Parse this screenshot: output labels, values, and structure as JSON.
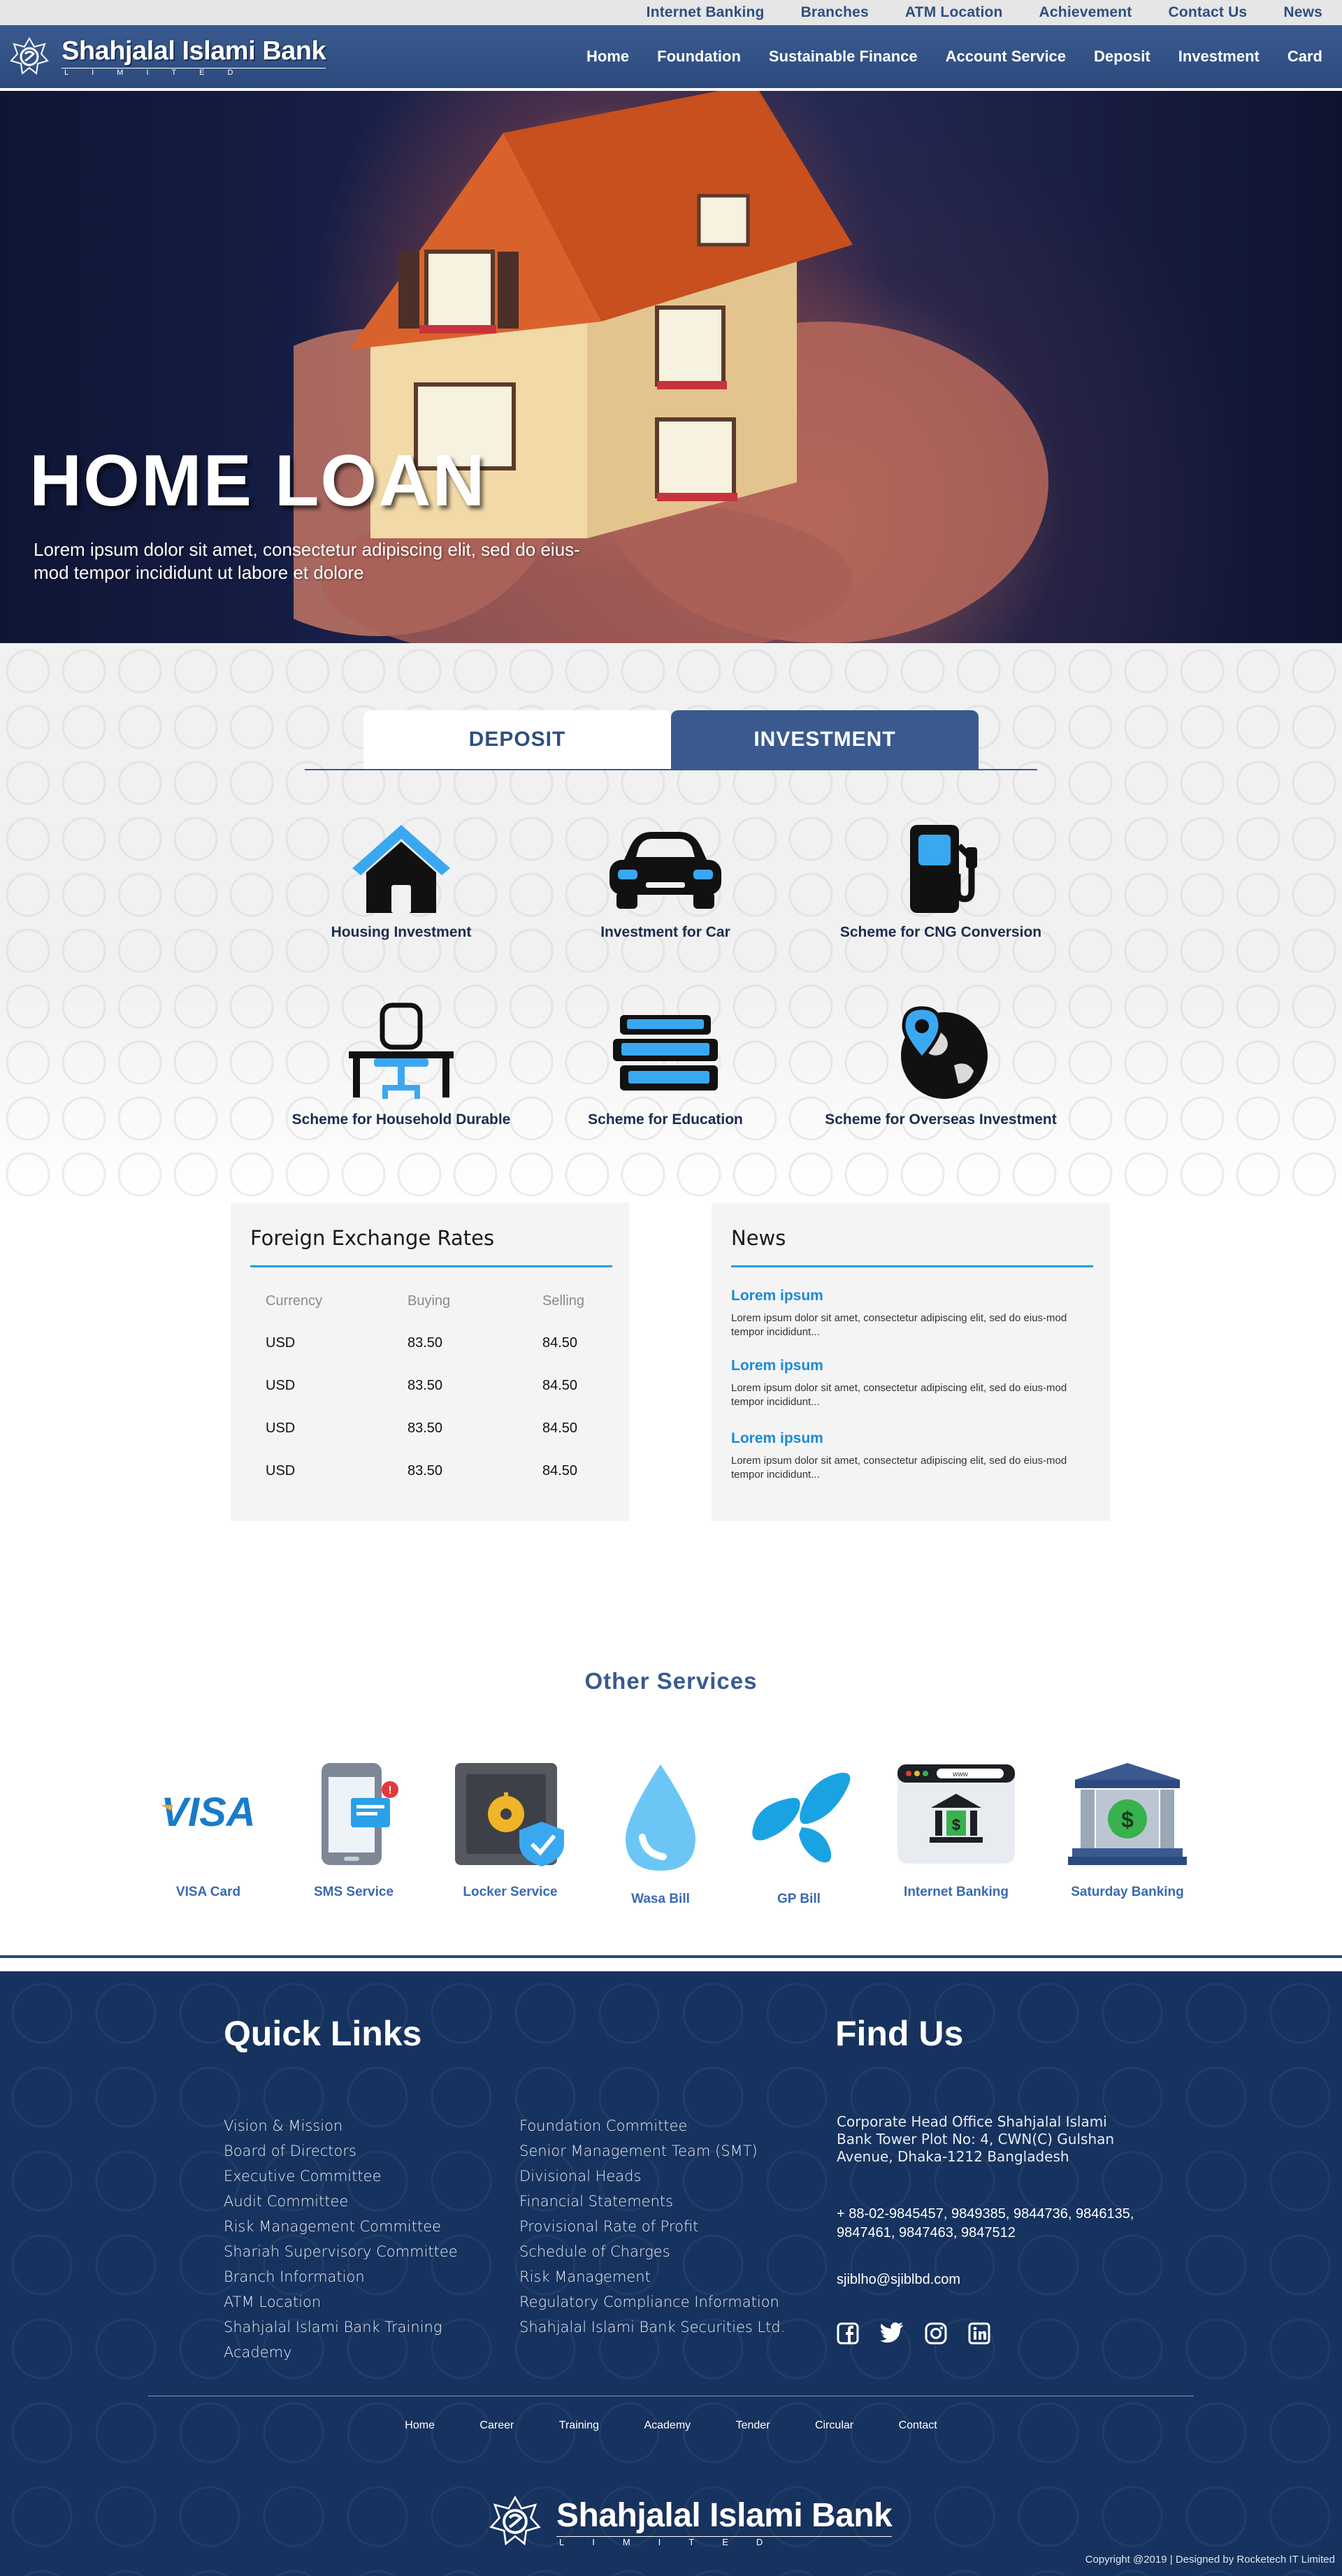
{
  "topbar": {
    "links": [
      "Internet Banking",
      "Branches",
      "ATM Location",
      "Achievement",
      "Contact Us",
      "News"
    ]
  },
  "header": {
    "logo_name": "Shahjalal Islami Bank",
    "logo_sub": "LIMITED",
    "nav": [
      "Home",
      "Foundation",
      "Sustainable Finance",
      "Account Service",
      "Deposit",
      "Investment",
      "Card"
    ]
  },
  "hero": {
    "title": "HOME LOAN",
    "caption": "Lorem ipsum dolor sit amet, consectetur adipiscing elit, sed do eius-mod tempor incididunt ut labore et dolore",
    "slides": 4,
    "active_slide": 1
  },
  "invest": {
    "tabs": [
      "DEPOSIT",
      "INVESTMENT"
    ],
    "active_tab": "INVESTMENT",
    "items": [
      {
        "label": "Housing Investment",
        "icon": "house-icon"
      },
      {
        "label": "Investment for Car",
        "icon": "car-icon"
      },
      {
        "label": "Scheme for CNG Conversion",
        "icon": "fuel-pump-icon"
      },
      {
        "label": "Scheme for Household Durable",
        "icon": "desk-chair-icon"
      },
      {
        "label": "Scheme for Education",
        "icon": "books-icon"
      },
      {
        "label": "Scheme for Overseas Investment",
        "icon": "globe-pin-icon"
      }
    ]
  },
  "rates": {
    "title": "Foreign Exchange Rates",
    "headers": [
      "Currency",
      "Buying",
      "Selling"
    ],
    "rows": [
      [
        "USD",
        "83.50",
        "84.50"
      ],
      [
        "USD",
        "83.50",
        "84.50"
      ],
      [
        "USD",
        "83.50",
        "84.50"
      ],
      [
        "USD",
        "83.50",
        "84.50"
      ]
    ]
  },
  "news": {
    "title": "News",
    "items": [
      {
        "title": "Lorem ipsum",
        "body": "Lorem ipsum dolor sit amet, consectetur adipiscing elit, sed do eius-mod tempor incididunt..."
      },
      {
        "title": "Lorem ipsum",
        "body": "Lorem ipsum dolor sit amet, consectetur adipiscing elit, sed do eius-mod tempor incididunt..."
      },
      {
        "title": "Lorem ipsum",
        "body": "Lorem ipsum dolor sit amet, consectetur adipiscing elit, sed do eius-mod tempor incididunt..."
      }
    ]
  },
  "services": {
    "title": "Other Services",
    "items": [
      {
        "label": "VISA Card",
        "icon": "visa-icon",
        "logo_text": "VISA"
      },
      {
        "label": "SMS Service",
        "icon": "phone-sms-icon"
      },
      {
        "label": "Locker Service",
        "icon": "safe-icon"
      },
      {
        "label": "Wasa Bill",
        "icon": "water-drop-icon"
      },
      {
        "label": "GP Bill",
        "icon": "gp-logo-icon"
      },
      {
        "label": "Internet Banking",
        "icon": "browser-bank-icon",
        "logo_text": "www"
      },
      {
        "label": "Saturday Banking",
        "icon": "bank-building-icon"
      }
    ]
  },
  "footer": {
    "quick_links_title": "Quick Links",
    "find_us_title": "Find Us",
    "links_col1": [
      "Vision & Mission",
      "Board of Directors",
      "Executive Committee",
      "Audit Committee",
      "Risk Management Committee",
      "Shariah Supervisory Committee",
      "Branch Information",
      "ATM Location",
      "Shahjalal Islami Bank Training",
      "Academy"
    ],
    "links_col2": [
      "Foundation Committee",
      "Senior Management Team (SMT)",
      "Divisional Heads",
      "Financial Statements",
      "Provisional Rate of Profit",
      "Schedule of Charges",
      "Risk Management",
      "Regulatory Compliance Information",
      "Shahjalal Islami Bank Securities Ltd."
    ],
    "address": "Corporate Head Office Shahjalal Islami Bank Tower Plot No: 4, CWN(C) Gulshan Avenue, Dhaka-1212 Bangladesh",
    "phone": "+ 88-02-9845457, 9849385, 9844736, 9846135, 9847461, 9847463, 9847512",
    "email": "sjiblho@sjiblbd.com",
    "social": [
      "facebook-icon",
      "twitter-icon",
      "instagram-icon",
      "linkedin-icon"
    ],
    "nav": [
      "Home",
      "Career",
      "Training",
      "Academy",
      "Tender",
      "Circular",
      "Contact"
    ],
    "logo_name": "Shahjalal Islami Bank",
    "logo_sub": "LIMITED",
    "copyright": "Copyright @2019 | Designed by Rocketech IT Limited"
  },
  "colors": {
    "brand_blue": "#2c4a7c",
    "accent_blue": "#1aa3e3",
    "footer_bg": "#16325e"
  }
}
